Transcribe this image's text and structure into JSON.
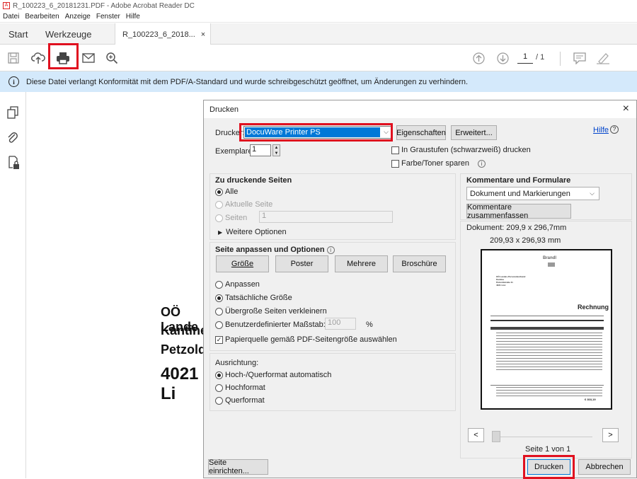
{
  "window": {
    "title": "R_100223_6_20181231.PDF - Adobe Acrobat Reader DC"
  },
  "menu": [
    "Datei",
    "Bearbeiten",
    "Anzeige",
    "Fenster",
    "Hilfe"
  ],
  "tabs": {
    "start": "Start",
    "tools": "Werkzeuge",
    "doc": "R_100223_6_2018...",
    "close": "×"
  },
  "toolbar": {
    "page_current": "1",
    "page_total": "/ 1"
  },
  "infobar": {
    "text": "Diese Datei verlangt Konformität mit dem PDF/A-Standard und wurde schreibgeschützt geöffnet, um Änderungen zu verhindern."
  },
  "document": {
    "lines": [
      "OÖ Lande",
      "Kantine",
      "Petzoldst",
      "4021 Li"
    ]
  },
  "dialog": {
    "title": "Drucken",
    "close": "×",
    "printer_label": "Drucker:",
    "printer_value": "DocuWare Printer PS",
    "properties": "Eigenschaften",
    "advanced": "Erweitert...",
    "help": "Hilfe",
    "copies_label": "Exemplare:",
    "copies_value": "1",
    "grayscale": "In Graustufen (schwarzweiß) drucken",
    "save_ink": "Farbe/Toner sparen",
    "pages_heading": "Zu druckende Seiten",
    "all": "Alle",
    "current_page": "Aktuelle Seite",
    "pages": "Seiten",
    "pages_value": "1",
    "more_options": "Weitere Optionen",
    "size_heading": "Seite anpassen und Optionen",
    "size_btn": "Größe",
    "poster_btn": "Poster",
    "multiple_btn": "Mehrere",
    "booklet_btn": "Broschüre",
    "fit": "Anpassen",
    "actual_size": "Tatsächliche Größe",
    "shrink": "Übergroße Seiten verkleinern",
    "custom_scale": "Benutzerdefinierter Maßstab:",
    "scale_value": "100",
    "percent": "%",
    "paper_source": "Papierquelle gemäß PDF-Seitengröße auswählen",
    "orientation_heading": "Ausrichtung:",
    "auto": "Hoch-/Querformat automatisch",
    "portrait": "Hochformat",
    "landscape": "Querformat",
    "comments_heading": "Kommentare und Formulare",
    "comments_value": "Dokument und Markierungen",
    "summarize": "Kommentare zusammenfassen",
    "doc_size": "Dokument: 209,9 x 296,7mm",
    "page_size": "209,93 x 296,93 mm",
    "page_counter": "Seite 1 von 1",
    "page_setup": "Seite einrichten...",
    "print": "Drucken",
    "cancel": "Abbrechen"
  },
  "preview": {
    "brand": "Brandl",
    "title": "Rechnung",
    "address": [
      "OÖ Landes-Personalverband",
      "Kantine",
      "Petzoldstraße 41",
      "4021 Linz"
    ],
    "total": "€ 303,19"
  },
  "colors": {
    "accent_red": "#e0101f",
    "select_blue": "#0078d7",
    "info_bg": "#d4e9fb"
  }
}
